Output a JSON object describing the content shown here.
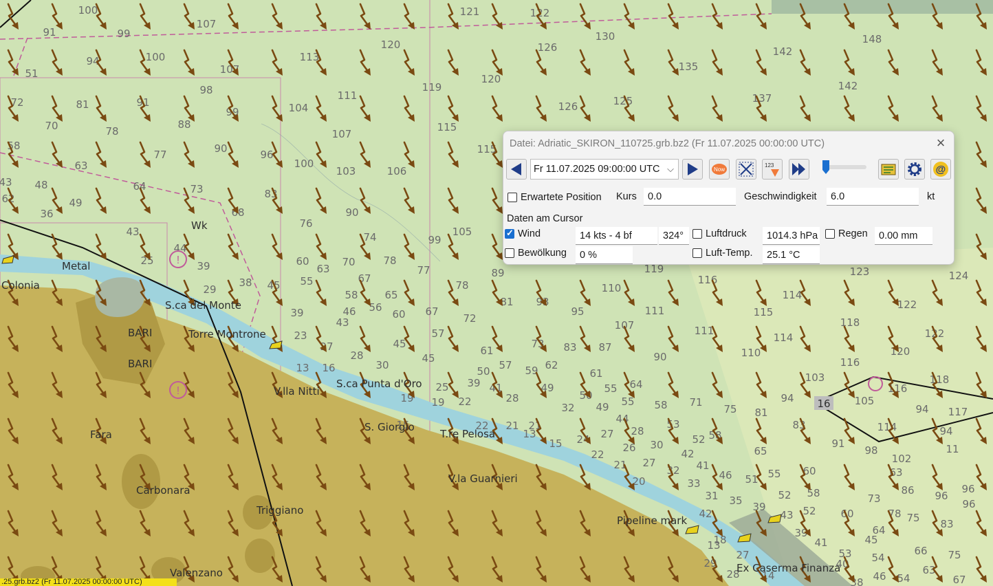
{
  "map": {
    "depths": [
      [
        "100",
        128,
        20
      ],
      [
        "107",
        300,
        40
      ],
      [
        "121",
        683,
        22
      ],
      [
        "122",
        785,
        24
      ],
      [
        "148",
        1268,
        62
      ],
      [
        "91",
        72,
        52
      ],
      [
        "99",
        180,
        54
      ],
      [
        "94",
        135,
        94
      ],
      [
        "100",
        226,
        88
      ],
      [
        "113",
        450,
        88
      ],
      [
        "120",
        568,
        70
      ],
      [
        "130",
        880,
        58
      ],
      [
        "126",
        796,
        74
      ],
      [
        "142",
        1138,
        80
      ],
      [
        "51",
        46,
        112
      ],
      [
        "107",
        334,
        106
      ],
      [
        "135",
        1001,
        102
      ],
      [
        "72",
        25,
        154
      ],
      [
        "81",
        120,
        157
      ],
      [
        "91",
        208,
        154
      ],
      [
        "98",
        300,
        136
      ],
      [
        "99",
        338,
        168
      ],
      [
        "104",
        434,
        162
      ],
      [
        "111",
        505,
        144
      ],
      [
        "119",
        628,
        132
      ],
      [
        "120",
        714,
        120
      ],
      [
        "126",
        826,
        160
      ],
      [
        "125",
        906,
        152
      ],
      [
        "137",
        1108,
        148
      ],
      [
        "142",
        1233,
        130
      ],
      [
        "70",
        75,
        188
      ],
      [
        "78",
        163,
        196
      ],
      [
        "88",
        268,
        186
      ],
      [
        "107",
        497,
        200
      ],
      [
        "115",
        650,
        190
      ],
      [
        "58",
        20,
        217
      ],
      [
        "115",
        708,
        222
      ],
      [
        "90",
        321,
        221
      ],
      [
        "77",
        233,
        230
      ],
      [
        "96",
        388,
        230
      ],
      [
        "100",
        442,
        243
      ],
      [
        "103",
        503,
        254
      ],
      [
        "106",
        577,
        254
      ],
      [
        "63",
        118,
        246
      ],
      [
        "48",
        60,
        274
      ],
      [
        "64",
        203,
        276
      ],
      [
        "73",
        286,
        280
      ],
      [
        "83",
        394,
        287
      ],
      [
        "43",
        8,
        270
      ],
      [
        "62",
        12,
        294
      ],
      [
        "49",
        110,
        300
      ],
      [
        "68",
        346,
        314
      ],
      [
        "90",
        512,
        314
      ],
      [
        "105",
        672,
        342
      ],
      [
        "36",
        68,
        316
      ],
      [
        "76",
        445,
        330
      ],
      [
        "99",
        632,
        354
      ],
      [
        "43",
        193,
        342
      ],
      [
        "74",
        538,
        350
      ],
      [
        "44",
        262,
        366
      ],
      [
        "39",
        296,
        392
      ],
      [
        "60",
        440,
        385
      ],
      [
        "63",
        470,
        396
      ],
      [
        "70",
        507,
        386
      ],
      [
        "78",
        567,
        384
      ],
      [
        "77",
        616,
        398
      ],
      [
        "89",
        724,
        402
      ],
      [
        "119",
        951,
        396
      ],
      [
        "116",
        1029,
        412
      ],
      [
        "123",
        1250,
        400
      ],
      [
        "124",
        1394,
        406
      ],
      [
        "25",
        214,
        384
      ],
      [
        "38",
        357,
        416
      ],
      [
        "45",
        398,
        420
      ],
      [
        "55",
        446,
        414
      ],
      [
        "67",
        530,
        410
      ],
      [
        "78",
        672,
        420
      ],
      [
        "110",
        889,
        424
      ],
      [
        "114",
        1152,
        434
      ],
      [
        "122",
        1319,
        448
      ],
      [
        "29",
        305,
        426
      ],
      [
        "58",
        511,
        434
      ],
      [
        "65",
        569,
        434
      ],
      [
        "81",
        737,
        444
      ],
      [
        "93",
        789,
        444
      ],
      [
        "95",
        840,
        458
      ],
      [
        "111",
        952,
        457
      ],
      [
        "115",
        1110,
        459
      ],
      [
        "118",
        1236,
        474
      ],
      [
        "39",
        432,
        460
      ],
      [
        "46",
        508,
        458
      ],
      [
        "56",
        546,
        452
      ],
      [
        "60",
        580,
        462
      ],
      [
        "67",
        628,
        458
      ],
      [
        "72",
        683,
        468
      ],
      [
        "107",
        908,
        478
      ],
      [
        "111",
        1024,
        486
      ],
      [
        "114",
        1139,
        496
      ],
      [
        "122",
        1359,
        490
      ],
      [
        "43",
        498,
        474
      ],
      [
        "23",
        437,
        493
      ],
      [
        "57",
        637,
        490
      ],
      [
        "73",
        782,
        505
      ],
      [
        "83",
        829,
        510
      ],
      [
        "87",
        880,
        510
      ],
      [
        "90",
        960,
        524
      ],
      [
        "110",
        1092,
        518
      ],
      [
        "120",
        1309,
        516
      ],
      [
        "27",
        475,
        509
      ],
      [
        "28",
        519,
        522
      ],
      [
        "45",
        581,
        505
      ],
      [
        "61",
        708,
        515
      ],
      [
        "30",
        556,
        536
      ],
      [
        "45",
        623,
        526
      ],
      [
        "57",
        735,
        536
      ],
      [
        "59",
        773,
        544
      ],
      [
        "62",
        802,
        536
      ],
      [
        "61",
        867,
        548
      ],
      [
        "64",
        925,
        564
      ],
      [
        "116",
        1236,
        532
      ],
      [
        "13",
        440,
        540
      ],
      [
        "16",
        478,
        540
      ],
      [
        "50",
        703,
        545
      ],
      [
        "39",
        689,
        562
      ],
      [
        "41",
        721,
        569
      ],
      [
        "49",
        796,
        569
      ],
      [
        "50",
        852,
        580
      ],
      [
        "55",
        888,
        570
      ],
      [
        "71",
        1012,
        590
      ],
      [
        "75",
        1062,
        600
      ],
      [
        "81",
        1107,
        605
      ],
      [
        "94",
        1145,
        584
      ],
      [
        "103",
        1185,
        554
      ],
      [
        "105",
        1257,
        588
      ],
      [
        "116",
        1305,
        570
      ],
      [
        "118",
        1366,
        557
      ],
      [
        "94",
        1341,
        600
      ],
      [
        "94",
        1376,
        632
      ],
      [
        "117",
        1393,
        604
      ],
      [
        "25",
        643,
        568
      ],
      [
        "19",
        592,
        584
      ],
      [
        "19",
        637,
        590
      ],
      [
        "22",
        676,
        589
      ],
      [
        "28",
        745,
        584
      ],
      [
        "32",
        826,
        598
      ],
      [
        "49",
        876,
        597
      ],
      [
        "55",
        913,
        589
      ],
      [
        "58",
        961,
        594
      ],
      [
        "83",
        1162,
        623
      ],
      [
        "114",
        1290,
        626
      ],
      [
        "91",
        1219,
        650
      ],
      [
        "98",
        1267,
        660
      ],
      [
        "11",
        1385,
        658
      ],
      [
        "102",
        1311,
        672
      ],
      [
        "44",
        905,
        614
      ],
      [
        "53",
        979,
        622
      ],
      [
        "52",
        1016,
        644
      ],
      [
        "58",
        1040,
        638
      ],
      [
        "42",
        1000,
        665
      ],
      [
        "41",
        1022,
        682
      ],
      [
        "65",
        1106,
        661
      ],
      [
        "15",
        586,
        623
      ],
      [
        "22",
        701,
        624
      ],
      [
        "21",
        778,
        624
      ],
      [
        "21",
        745,
        624
      ],
      [
        "15",
        808,
        650
      ],
      [
        "24",
        848,
        644
      ],
      [
        "27",
        883,
        636
      ],
      [
        "28",
        927,
        632
      ],
      [
        "26",
        915,
        656
      ],
      [
        "30",
        955,
        652
      ],
      [
        "22",
        869,
        666
      ],
      [
        "21",
        902,
        681
      ],
      [
        "27",
        944,
        678
      ],
      [
        "32",
        979,
        689
      ],
      [
        "46",
        1055,
        696
      ],
      [
        "51",
        1093,
        702
      ],
      [
        "55",
        1126,
        694
      ],
      [
        "60",
        1177,
        690
      ],
      [
        "63",
        1303,
        692
      ],
      [
        "86",
        1320,
        718
      ],
      [
        "96",
        1369,
        726
      ],
      [
        "96",
        1408,
        716
      ],
      [
        "13",
        770,
        636
      ],
      [
        "20",
        929,
        705
      ],
      [
        "33",
        1009,
        708
      ],
      [
        "31",
        1035,
        726
      ],
      [
        "35",
        1070,
        733
      ],
      [
        "39",
        1104,
        742
      ],
      [
        "52",
        1141,
        725
      ],
      [
        "58",
        1183,
        722
      ],
      [
        "73",
        1271,
        730
      ],
      [
        "75",
        1328,
        758
      ],
      [
        "83",
        1377,
        767
      ],
      [
        "96",
        1409,
        738
      ],
      [
        "43",
        1144,
        754
      ],
      [
        "52",
        1177,
        748
      ],
      [
        "60",
        1232,
        752
      ],
      [
        "64",
        1278,
        776
      ],
      [
        "78",
        1301,
        752
      ],
      [
        "42",
        1026,
        752
      ],
      [
        "18",
        1047,
        790
      ],
      [
        "39",
        1165,
        780
      ],
      [
        "45",
        1267,
        790
      ],
      [
        "53",
        1229,
        810
      ],
      [
        "54",
        1277,
        816
      ],
      [
        "66",
        1339,
        806
      ],
      [
        "75",
        1388,
        812
      ],
      [
        "63",
        1351,
        834
      ],
      [
        "41",
        1194,
        794
      ],
      [
        "27",
        1080,
        812
      ],
      [
        "40",
        1225,
        825
      ],
      [
        "46",
        1279,
        843
      ],
      [
        "54",
        1314,
        846
      ],
      [
        "67",
        1395,
        848
      ],
      [
        "38",
        1246,
        852
      ],
      [
        "28",
        1066,
        840
      ],
      [
        "29",
        1033,
        824
      ],
      [
        "14",
        1117,
        842
      ],
      [
        "13",
        1038,
        798
      ]
    ],
    "places": [
      [
        "Wk",
        278,
        333
      ],
      [
        "Metal",
        90,
        392
      ],
      [
        "S.ca del Monte",
        240,
        449
      ],
      [
        "BARI",
        186,
        489
      ],
      [
        "Torre Montrone",
        274,
        491
      ],
      [
        "BARI",
        186,
        534
      ],
      [
        "V.lla Nitti",
        398,
        574
      ],
      [
        "S.ca Punta d'Oro",
        489,
        563
      ],
      [
        "S. Giorgio",
        530,
        626
      ],
      [
        "T.re Pelosa",
        640,
        636
      ],
      [
        "Fara",
        131,
        637
      ],
      [
        "V.la Guarnieri",
        652,
        701
      ],
      [
        "Carbonara",
        198,
        718
      ],
      [
        "Triggiano",
        373,
        747
      ],
      [
        "Pipeline mark",
        897,
        762
      ],
      [
        "Valenzano",
        247,
        838
      ],
      [
        "Ex Caserma Finanza",
        1071,
        831
      ],
      [
        "Colonia",
        2,
        420
      ]
    ],
    "badge": "16"
  },
  "status_strip": ".25.grb.bz2 (Fr 11.07.2025 00:00:00 UTC)",
  "dialog": {
    "title": "Datei: Adriatic_SKIRON_110725.grb.bz2 (Fr 11.07.2025 00:00:00 UTC)",
    "time_value": "Fr 11.07.2025 09:00:00 UTC",
    "now_label": "Now",
    "num_label": "123",
    "expected_position_label": "Erwartete Position",
    "course_label": "Kurs",
    "course_value": "0.0",
    "speed_label": "Geschwindigkeit",
    "speed_value": "6.0",
    "speed_unit": "kt",
    "cursor_data_label": "Daten am Cursor",
    "wind_label": "Wind",
    "wind_value": "14 kts -  4 bf",
    "wind_dir": "324°",
    "pressure_label": "Luftdruck",
    "pressure_value": "1014.3 hPa",
    "rain_label": "Regen",
    "rain_value": "0.00 mm",
    "cloud_label": "Bewölkung",
    "cloud_value": "0 %",
    "airtemp_label": "Luft-Temp.",
    "airtemp_value": "25.1 °C",
    "wind_checked": true
  },
  "colors": {
    "land": "#c6b25b",
    "sea_shallow": "#9fd3dd",
    "sea": "#cfe3b5",
    "arrow": "#7a4a12",
    "accent": "#1a6fd0"
  }
}
